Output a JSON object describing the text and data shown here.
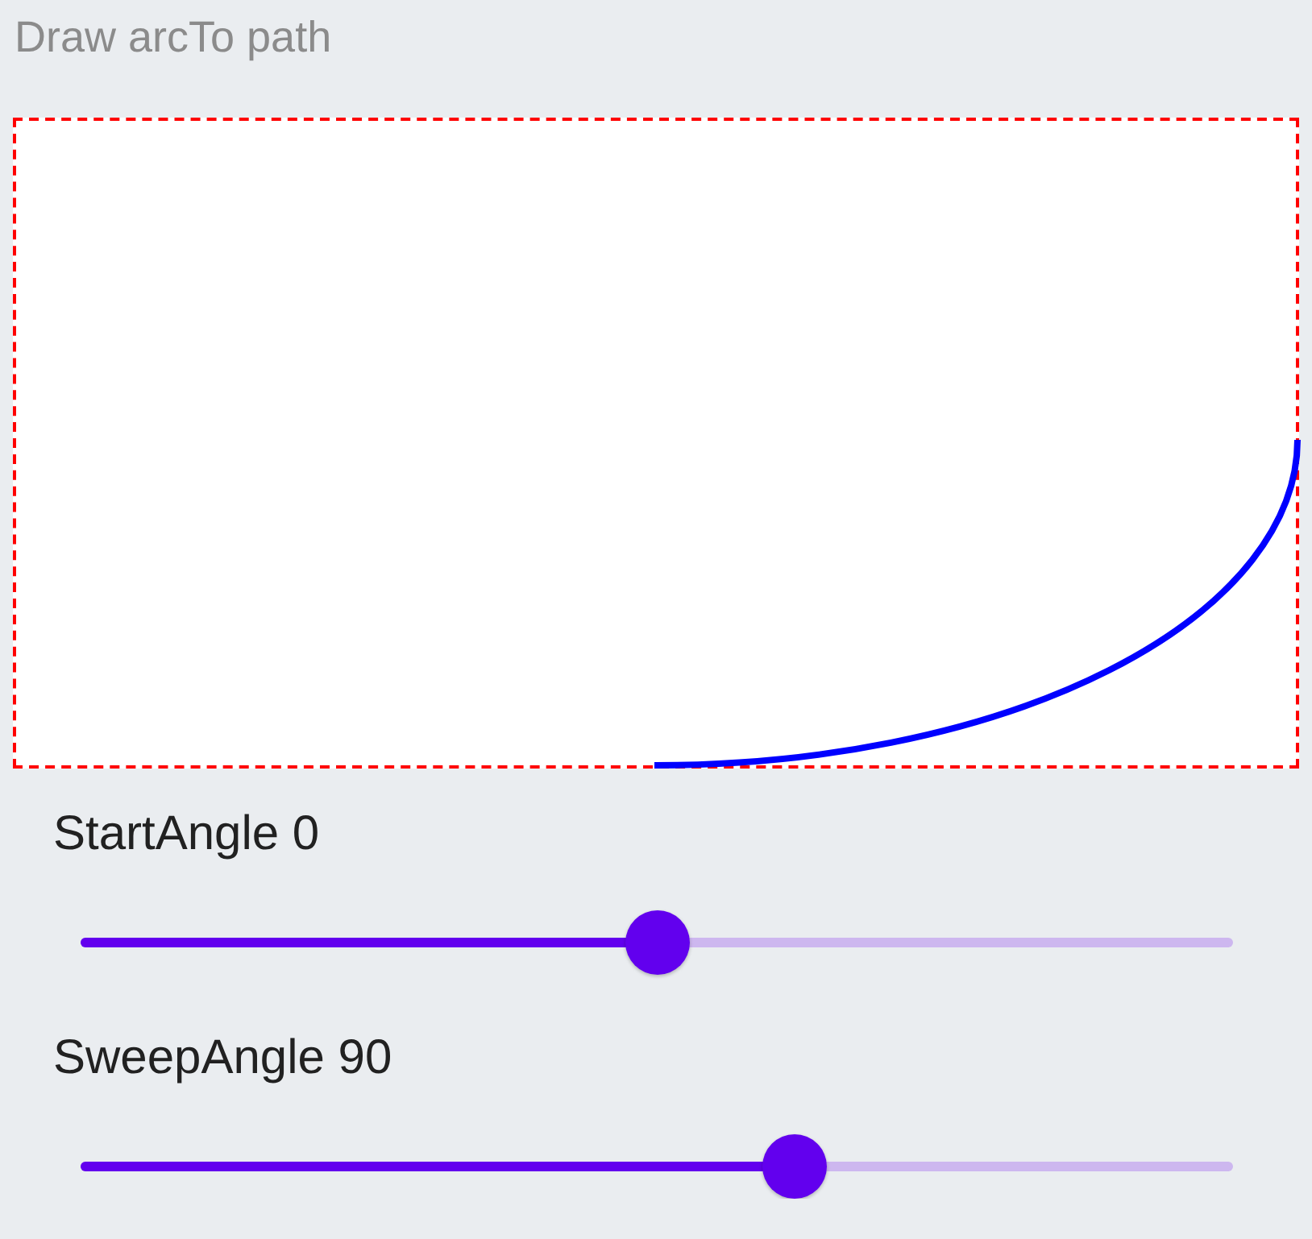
{
  "title": "Draw arcTo path",
  "sliders": [
    {
      "label": "StartAngle 0",
      "level": 0.5
    },
    {
      "label": "SweepAngle 90",
      "level": 0.62
    }
  ]
}
